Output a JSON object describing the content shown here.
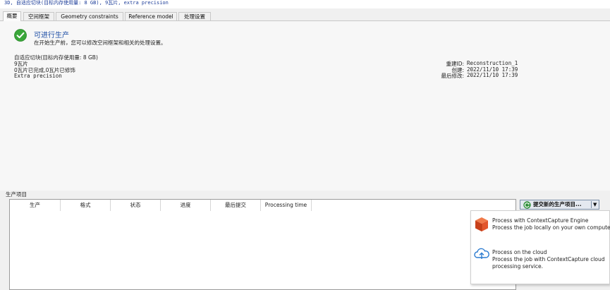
{
  "header": {
    "summary_line": "3D, 自适应切块(目标内存使用量: 8 GB), 9瓦片, extra precision"
  },
  "tabs": [
    {
      "label": "概要",
      "active": true
    },
    {
      "label": "空间框架",
      "active": false
    },
    {
      "label": "Geometry constraints",
      "active": false
    },
    {
      "label": "Reference model",
      "active": false
    },
    {
      "label": "处理设置",
      "active": false
    }
  ],
  "status": {
    "icon": "check-circle-icon",
    "title": "可进行生产",
    "description": "在开始生产前，您可以修改空间框架和相关的处理设置。"
  },
  "info": {
    "tiling": "自适应切块(目标内存使用量: 8 GB)",
    "tiles": "9瓦片",
    "progress": "0瓦片已完成,0瓦片已修饰",
    "precision": "Extra precision"
  },
  "meta": {
    "id_label": "重建ID:",
    "id_value": "Reconstruction_1",
    "created_label": "创建:",
    "created_value": "2022/11/10 17:39",
    "modified_label": "最后修改:",
    "modified_value": "2022/11/10 17:39"
  },
  "productions": {
    "section_label": "生产项目",
    "columns": [
      "生产",
      "格式",
      "状态",
      "进度",
      "最后提交",
      "Processing time"
    ],
    "rows": []
  },
  "submit_button": {
    "icon": "refresh-icon",
    "label": "提交新的生产项目...",
    "dropdown_icon": "triangle-down-icon"
  },
  "submit_menu": {
    "items": [
      {
        "icon": "cube-icon",
        "title": "Process with ContextCapture Engine",
        "subtitle": "Process the job locally on your own computers."
      },
      {
        "icon": "cloud-upload-icon",
        "title": "Process on the cloud",
        "subtitle": "Process the job with ContextCapture cloud",
        "subtitle2": "processing service."
      }
    ]
  },
  "colors": {
    "accent_blue": "#1f4fa6",
    "success_green": "#3aa63a",
    "cube_red": "#d84a22"
  }
}
